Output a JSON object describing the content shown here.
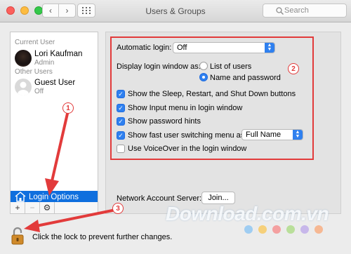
{
  "window": {
    "title": "Users & Groups"
  },
  "search": {
    "placeholder": "Search"
  },
  "sidebar": {
    "current_user_label": "Current User",
    "other_users_label": "Other Users",
    "users": [
      {
        "name": "Lori Kaufman",
        "role": "Admin"
      },
      {
        "name": "Guest User",
        "role": "Off"
      }
    ],
    "login_options_label": "Login Options",
    "toolbar": {
      "add": "+",
      "remove": "−",
      "gear": "⚙"
    }
  },
  "login": {
    "automatic_login_label": "Automatic login:",
    "automatic_login_value": "Off",
    "display_window_label": "Display login window as:",
    "radio_options": [
      {
        "label": "List of users",
        "selected": false
      },
      {
        "label": "Name and password",
        "selected": true
      }
    ],
    "checkboxes": [
      {
        "label": "Show the Sleep, Restart, and Shut Down buttons",
        "checked": true
      },
      {
        "label": "Show Input menu in login window",
        "checked": true
      },
      {
        "label": "Show password hints",
        "checked": true
      },
      {
        "label": "Show fast user switching menu as",
        "checked": true
      },
      {
        "label": "Use VoiceOver in the login window",
        "checked": false
      }
    ],
    "fast_switch_value": "Full Name",
    "network_label": "Network Account Server:",
    "join_label": "Join..."
  },
  "lock": {
    "text": "Click the lock to prevent further changes."
  },
  "callouts": [
    "1",
    "2",
    "3"
  ],
  "watermark": "Download.com.vn",
  "colors": {
    "accent": "#2f80ef",
    "selection": "#0f6fde",
    "annotation": "#e23b3b"
  }
}
